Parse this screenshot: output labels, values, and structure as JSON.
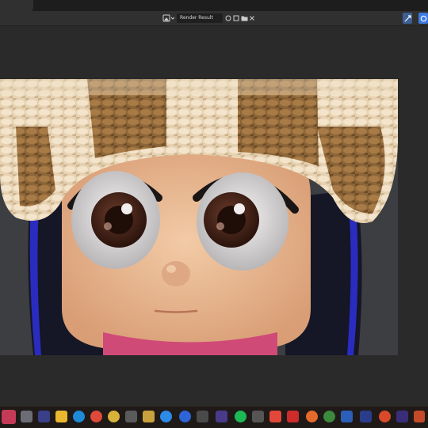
{
  "image_editor": {
    "image_name": "Render Result",
    "icons": [
      "image-type-icon",
      "browse-image-icon",
      "fake-user-icon",
      "new-image-icon",
      "open-image-icon",
      "close-icon"
    ]
  },
  "header_right": {
    "icons": [
      "overlay-icon",
      "viewport-shading-icon"
    ]
  },
  "taskbar": {
    "icons": [
      "start-icon",
      "task-view-icon",
      "app-icon",
      "file-explorer-icon",
      "edge-icon",
      "chrome-icon",
      "chrome-profile-icon",
      "calculator-icon",
      "chrome-alt-icon",
      "zoom-icon",
      "app-icon",
      "jw-app-icon",
      "spotify-icon",
      "app-icon",
      "camera-icon",
      "acrobat-icon",
      "chrome-icon",
      "chrome-icon",
      "app-icon",
      "app-icon",
      "photoshop-icon",
      "blender-icon",
      "app-icon",
      "app-icon"
    ]
  },
  "colors": {
    "accent": "#3b7be0",
    "render_background": "#3c3e42",
    "hat_light": "#ead8bc",
    "hat_dark": "#9a7040",
    "skin": "#e8bc96",
    "hair": "#151626",
    "collar": "#d04a78"
  }
}
